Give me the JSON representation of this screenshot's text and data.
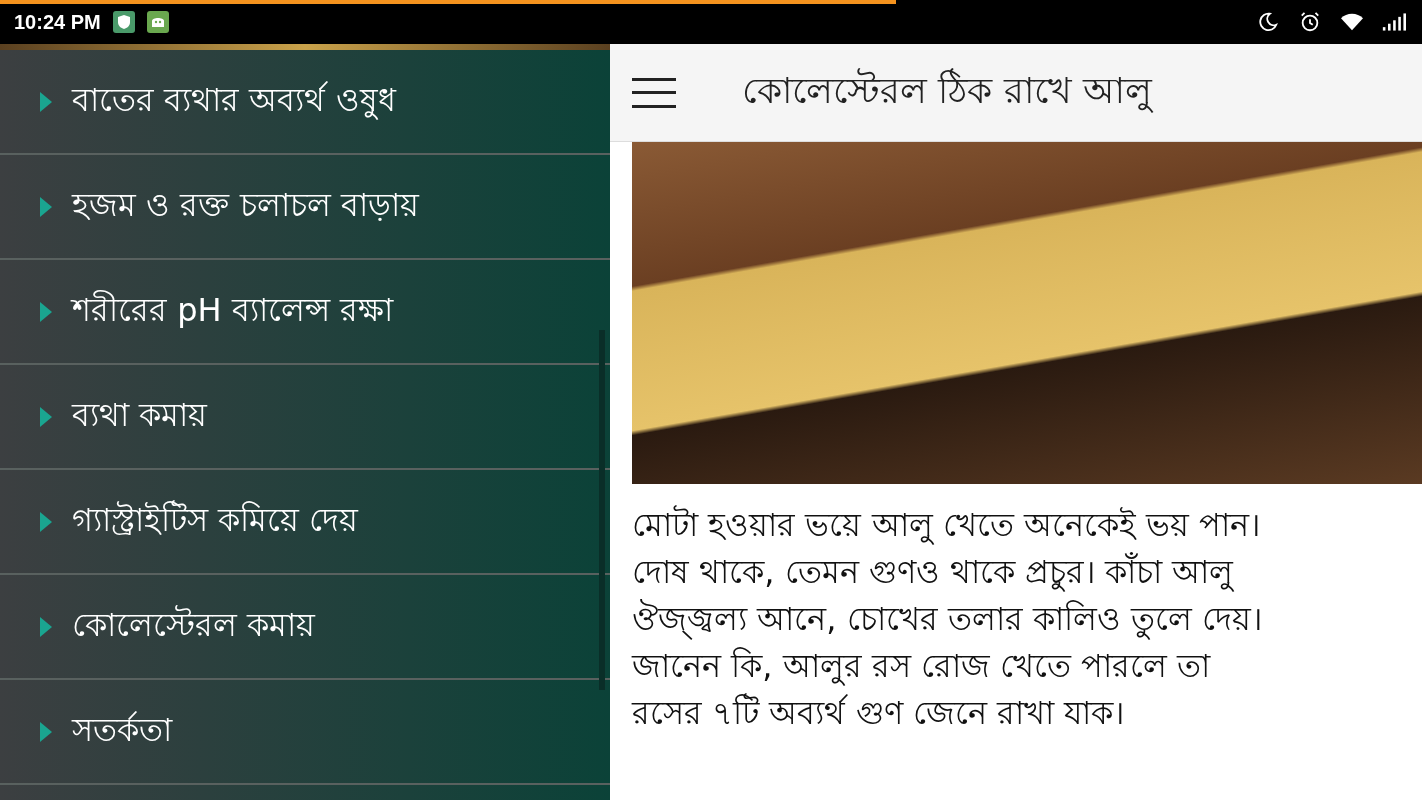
{
  "status_bar": {
    "time": "10:24 PM",
    "progress": {
      "level": 0.63
    }
  },
  "drawer": {
    "items": [
      {
        "label": "বাতের ব্যথার অব্যর্থ ওষুধ"
      },
      {
        "label": "হজম ও রক্ত চলাচল বাড়ায়"
      },
      {
        "label": "শরীরের pH ব্যালেন্স রক্ষা"
      },
      {
        "label": "ব্যথা কমায়"
      },
      {
        "label": "গ্যাস্ট্রাইটিস কমিয়ে দেয়"
      },
      {
        "label": "কোলেস্টেরল কমায়"
      },
      {
        "label": "সতর্কতা"
      }
    ]
  },
  "toolbar": {
    "title": "কোলেস্টেরল ঠিক রাখে আলু"
  },
  "article": {
    "lines": [
      "মোটা হওয়ার ভয়ে আলু খেতে অনেকেই ভয় পান।",
      "দোষ থাকে, তেমন গুণও থাকে প্রচুর। কাঁচা আলু",
      "ঔজ্জ্বল্য আনে, চোখের তলার কালিও তুলে দেয়।",
      "জানেন কি, আলুর রস রোজ খেতে পারলে তা",
      "রসের ৭টি অব্যর্থ গুণ জেনে রাখা যাক।"
    ]
  }
}
